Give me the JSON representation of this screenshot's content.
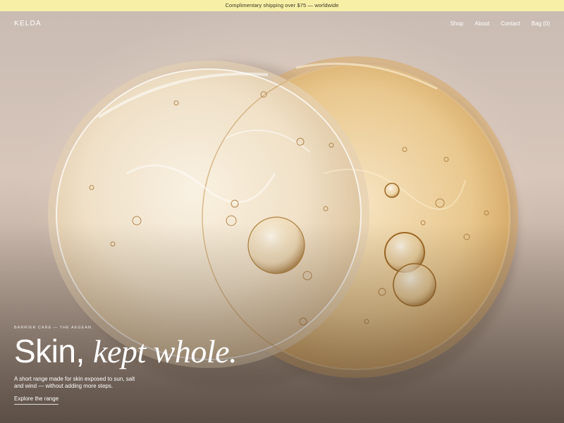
{
  "announcement": "Complimentary shipping over $75 — worldwide",
  "brand": "KELDA",
  "nav": {
    "shop": "Shop",
    "about": "About",
    "contact": "Contact",
    "bag": "Bag (0)"
  },
  "hero": {
    "eyebrow": "BARRIER CARE — THE AEGEAN",
    "headline_plain": "Skin,",
    "headline_italic": "kept whole.",
    "subtext": "A short range made for skin exposed to sun, salt and wind — without adding more steps.",
    "cta": "Explore the range"
  },
  "colors": {
    "announcement_bg": "#f7efa5",
    "text_on_hero": "#ffffff"
  }
}
